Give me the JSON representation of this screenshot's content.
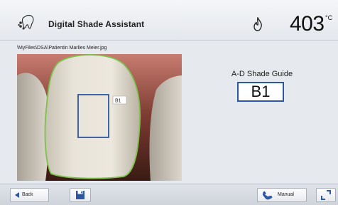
{
  "header": {
    "title": "Digital Shade Assistant",
    "temperature": "403",
    "temperature_unit": "°C"
  },
  "file_path": "\\MyFiles\\DSA\\Patientin Marlies Meier.jpg",
  "image": {
    "measurement_label": "B1"
  },
  "shade_guide": {
    "title": "A-D Shade Guide",
    "result": "B1"
  },
  "footer": {
    "back_label": "Back",
    "manual_label": "Manual"
  },
  "colors": {
    "accent": "#2c57a3",
    "tooth_outline": "#7cc24a"
  }
}
